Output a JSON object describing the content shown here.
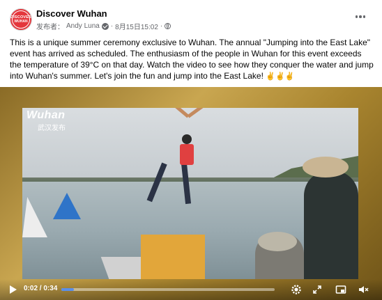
{
  "post": {
    "page_name": "Discover Wuhan",
    "avatar_text": [
      "DISCOVER",
      "WUHAN"
    ],
    "publisher_label": "发布者：",
    "author": "Andy Luna",
    "date": "8月15日15:02",
    "separator": "·",
    "body": "This is a unique summer ceremony exclusive to Wuhan. The annual \"Jumping into the East Lake\" event has arrived as scheduled. The enthusiasm of the people in Wuhan for this event exceeds the temperature of 39°C on that day. Watch the video to see how they conquer the water and jump into Wuhan's summer. Let's join the fun and jump into the East Lake!",
    "emoji": [
      "✌",
      "✌",
      "✌"
    ]
  },
  "video": {
    "watermark_main": "Wuhan",
    "watermark_sub": "武汉发布",
    "current_time": "0:02",
    "time_separator": "/",
    "duration": "0:34",
    "progress_fraction": 0.06
  },
  "icons": {
    "more": "more-horizontal-icon",
    "verified": "verified-check-icon",
    "audience": "globe-icon",
    "play": "play-icon",
    "settings": "gear-icon",
    "expand": "expand-icon",
    "pip": "picture-in-picture-icon",
    "mute": "volume-muted-icon"
  },
  "colors": {
    "avatar": "#e4363c",
    "progress": "#5b8fe8",
    "frame": "#b08c38"
  }
}
